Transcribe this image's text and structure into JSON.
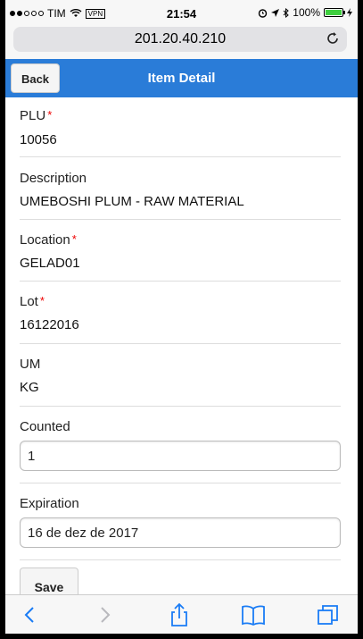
{
  "status_bar": {
    "carrier": "TIM",
    "vpn": "VPN",
    "time": "21:54",
    "battery": "100%",
    "battery_level": 1.0
  },
  "browser": {
    "url": "201.20.40.210"
  },
  "header": {
    "back_label": "Back",
    "title": "Item Detail"
  },
  "fields": {
    "plu": {
      "label": "PLU",
      "value": "10056",
      "required_mark": "*"
    },
    "description": {
      "label": "Description",
      "value": "UMEBOSHI PLUM - RAW MATERIAL"
    },
    "location": {
      "label": "Location",
      "value": "GELAD01",
      "required_mark": "*"
    },
    "lot": {
      "label": "Lot",
      "value": "16122016",
      "required_mark": "*"
    },
    "um": {
      "label": "UM",
      "value": "KG"
    },
    "counted": {
      "label": "Counted",
      "value": "1"
    },
    "expiration": {
      "label": "Expiration",
      "value": "16 de dez de 2017"
    }
  },
  "actions": {
    "save_label": "Save"
  },
  "colors": {
    "header_bg": "#2a7cd8",
    "required": "#e00000",
    "toolbar_icons": "#1a7cf5"
  }
}
